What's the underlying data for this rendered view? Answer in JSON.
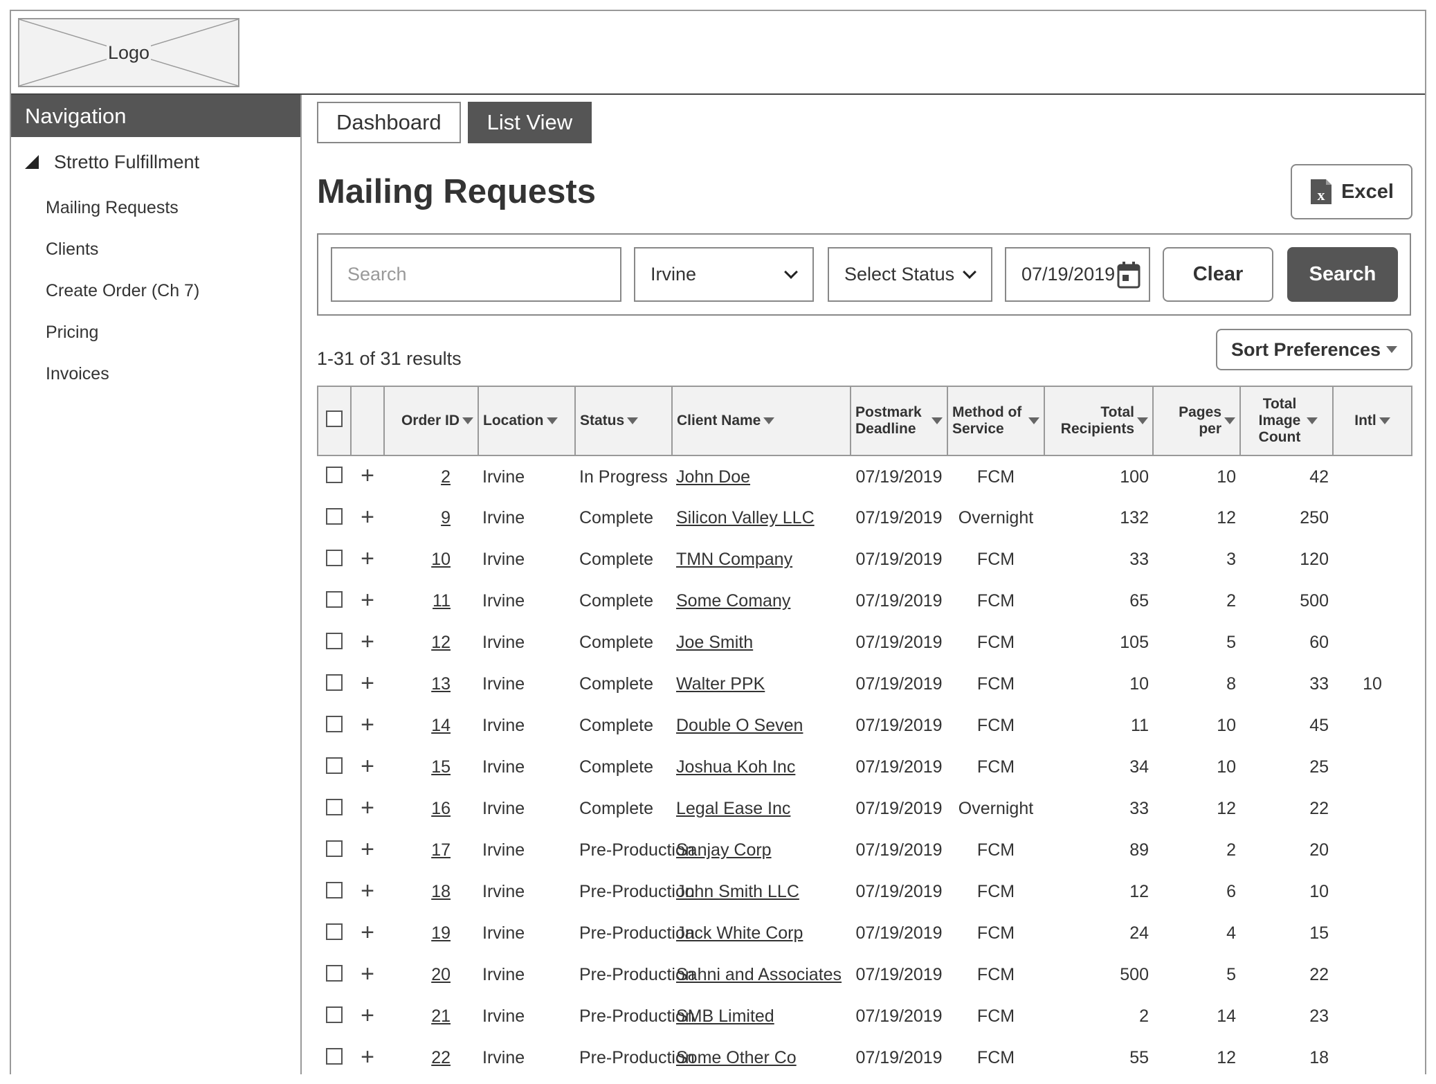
{
  "header": {
    "logo_text": "Logo"
  },
  "sidebar": {
    "title": "Navigation",
    "group": "Stretto Fulfillment",
    "items": [
      {
        "label": "Mailing Requests"
      },
      {
        "label": "Clients"
      },
      {
        "label": "Create Order (Ch 7)"
      },
      {
        "label": "Pricing"
      },
      {
        "label": "Invoices"
      }
    ]
  },
  "tabs": [
    {
      "label": "Dashboard",
      "active": false
    },
    {
      "label": "List View",
      "active": true
    }
  ],
  "page": {
    "title": "Mailing Requests",
    "excel_label": "Excel",
    "excel_icon": "excel-icon"
  },
  "filters": {
    "search_placeholder": "Search",
    "location": "Irvine",
    "status": "Select Status",
    "date": "07/19/2019",
    "clear_label": "Clear",
    "search_label": "Search"
  },
  "results": {
    "count_text": "1-31 of 31 results",
    "sort_label": "Sort Preferences"
  },
  "table": {
    "headers": {
      "order_id": "Order ID",
      "location": "Location",
      "status": "Status",
      "client": "Client Name",
      "postmark": "Postmark Deadline",
      "method": "Method of Service",
      "recipients": "Total Recipients",
      "pages": "Pages per",
      "images": "Total Image Count",
      "intl": "Intl"
    },
    "rows": [
      {
        "id": "2",
        "location": "Irvine",
        "status": "In Progress",
        "client": "John Doe",
        "postmark": "07/19/2019",
        "method": "FCM",
        "recipients": "100",
        "pages": "10",
        "images": "42",
        "intl": ""
      },
      {
        "id": "9",
        "location": "Irvine",
        "status": "Complete",
        "client": "Silicon Valley LLC",
        "postmark": "07/19/2019",
        "method": "Overnight",
        "recipients": "132",
        "pages": "12",
        "images": "250",
        "intl": ""
      },
      {
        "id": "10",
        "location": "Irvine",
        "status": "Complete",
        "client": "TMN Company",
        "postmark": "07/19/2019",
        "method": "FCM",
        "recipients": "33",
        "pages": "3",
        "images": "120",
        "intl": ""
      },
      {
        "id": "11",
        "location": "Irvine",
        "status": "Complete",
        "client": "Some Comany",
        "postmark": "07/19/2019",
        "method": "FCM",
        "recipients": "65",
        "pages": "2",
        "images": "500",
        "intl": ""
      },
      {
        "id": "12",
        "location": "Irvine",
        "status": "Complete",
        "client": "Joe Smith",
        "postmark": "07/19/2019",
        "method": "FCM",
        "recipients": "105",
        "pages": "5",
        "images": "60",
        "intl": ""
      },
      {
        "id": "13",
        "location": "Irvine",
        "status": "Complete",
        "client": "Walter PPK",
        "postmark": "07/19/2019",
        "method": "FCM",
        "recipients": "10",
        "pages": "8",
        "images": "33",
        "intl": "10"
      },
      {
        "id": "14",
        "location": "Irvine",
        "status": "Complete",
        "client": "Double O Seven",
        "postmark": "07/19/2019",
        "method": "FCM",
        "recipients": "11",
        "pages": "10",
        "images": "45",
        "intl": ""
      },
      {
        "id": "15",
        "location": "Irvine",
        "status": "Complete",
        "client": "Joshua Koh Inc",
        "postmark": "07/19/2019",
        "method": "FCM",
        "recipients": "34",
        "pages": "10",
        "images": "25",
        "intl": ""
      },
      {
        "id": "16",
        "location": "Irvine",
        "status": "Complete",
        "client": "Legal Ease Inc",
        "postmark": "07/19/2019",
        "method": "Overnight",
        "recipients": "33",
        "pages": "12",
        "images": "22",
        "intl": ""
      },
      {
        "id": "17",
        "location": "Irvine",
        "status": "Pre-Production",
        "client": "Sanjay Corp",
        "postmark": "07/19/2019",
        "method": "FCM",
        "recipients": "89",
        "pages": "2",
        "images": "20",
        "intl": ""
      },
      {
        "id": "18",
        "location": "Irvine",
        "status": "Pre-Production",
        "client": "John Smith LLC",
        "postmark": "07/19/2019",
        "method": "FCM",
        "recipients": "12",
        "pages": "6",
        "images": "10",
        "intl": ""
      },
      {
        "id": "19",
        "location": "Irvine",
        "status": "Pre-Production",
        "client": "Jack White Corp",
        "postmark": "07/19/2019",
        "method": "FCM",
        "recipients": "24",
        "pages": "4",
        "images": "15",
        "intl": ""
      },
      {
        "id": "20",
        "location": "Irvine",
        "status": "Pre-Production",
        "client": "Sahni and Associates",
        "postmark": "07/19/2019",
        "method": "FCM",
        "recipients": "500",
        "pages": "5",
        "images": "22",
        "intl": ""
      },
      {
        "id": "21",
        "location": "Irvine",
        "status": "Pre-Production",
        "client": "SMB Limited",
        "postmark": "07/19/2019",
        "method": "FCM",
        "recipients": "2",
        "pages": "14",
        "images": "23",
        "intl": ""
      },
      {
        "id": "22",
        "location": "Irvine",
        "status": "Pre-Production",
        "client": "Some Other Co",
        "postmark": "07/19/2019",
        "method": "FCM",
        "recipients": "55",
        "pages": "12",
        "images": "18",
        "intl": ""
      }
    ]
  },
  "colors": {
    "dark": "#555555",
    "border": "#999999",
    "header_bg": "#f2f2f2",
    "text": "#333333"
  }
}
